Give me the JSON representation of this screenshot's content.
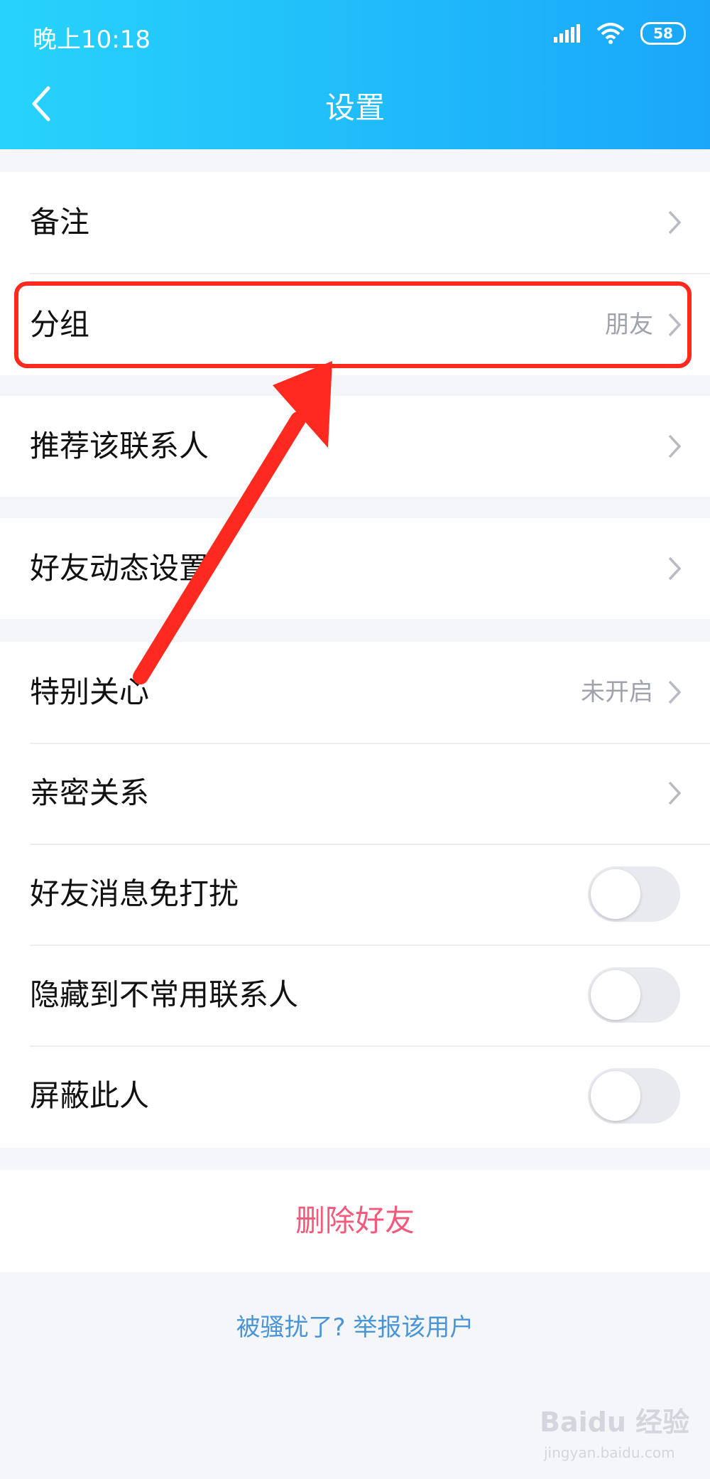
{
  "status_bar": {
    "time": "晚上10:18",
    "battery": "58",
    "signal_icon": "signal-icon",
    "wifi_icon": "wifi-icon"
  },
  "header": {
    "title": "设置",
    "back_icon": "back-chevron-icon"
  },
  "groups": [
    {
      "items": [
        {
          "label": "备注",
          "value": ""
        },
        {
          "label": "分组",
          "value": "朋友"
        }
      ]
    },
    {
      "items": [
        {
          "label": "推荐该联系人",
          "value": ""
        }
      ]
    },
    {
      "items": [
        {
          "label": "好友动态设置",
          "value": ""
        }
      ]
    },
    {
      "items": [
        {
          "label": "特别关心",
          "value": "未开启"
        },
        {
          "label": "亲密关系",
          "value": ""
        },
        {
          "label": "好友消息免打扰",
          "toggle": false
        },
        {
          "label": "隐藏到不常用联系人",
          "toggle": false
        },
        {
          "label": "屏蔽此人",
          "toggle": false
        }
      ]
    }
  ],
  "delete_button": "删除好友",
  "report_link": "被骚扰了? 举报该用户",
  "watermark": {
    "brand": "Baidu 经验",
    "url": "jingyan.baidu.com"
  },
  "colors": {
    "header_start": "#27d3fb",
    "header_end": "#1aa7fa",
    "delete": "#f25a7c",
    "link": "#4a95d8",
    "annotation": "#ff2a1f"
  }
}
